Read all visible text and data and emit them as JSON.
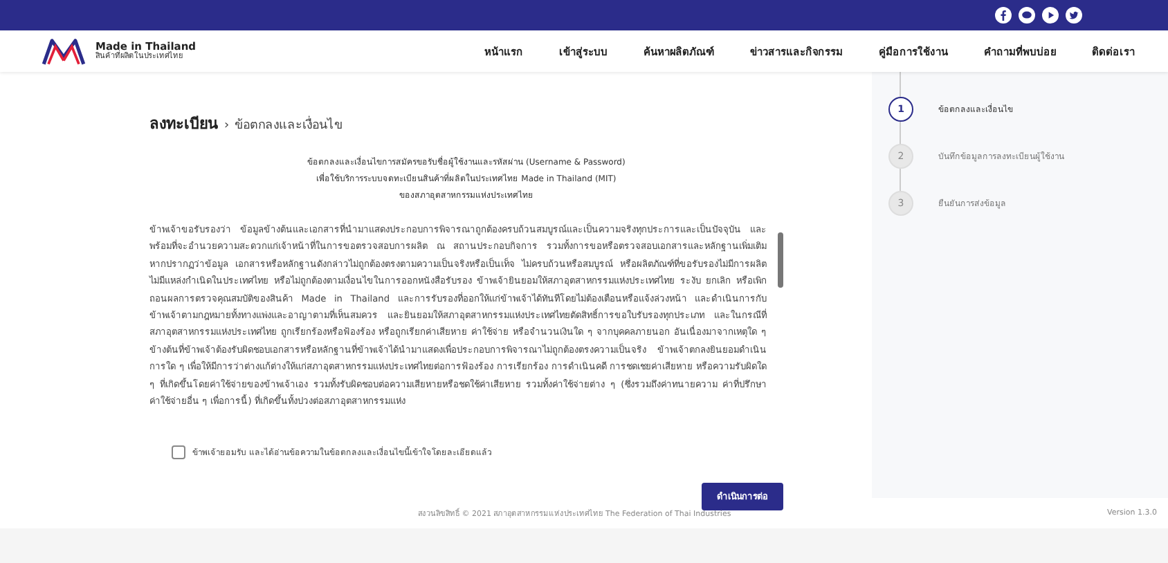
{
  "social_links": [
    {
      "kind": "facebook"
    },
    {
      "kind": "line"
    },
    {
      "kind": "youtube"
    },
    {
      "kind": "twitter"
    }
  ],
  "logo": {
    "title": "Made in Thailand",
    "subtitle": "สินค้าที่ผลิตในประเทศไทย"
  },
  "nav": [
    "หน้าแรก",
    "เข้าสู่ระบบ",
    "ค้นหาผลิตภัณฑ์",
    "ข่าวสารและกิจกรรม",
    "คู่มือการใช้งาน",
    "คำถามที่พบบ่อย",
    "ติดต่อเรา"
  ],
  "breadcrumb": {
    "parent": "ลงทะเบียน",
    "separator": "›",
    "current": "ข้อตกลงและเงื่อนไข"
  },
  "terms_title": [
    "ข้อตกลงและเงื่อนไขการสมัครขอรับชื่อผู้ใช้งานและรหัสผ่าน (Username & Password)",
    "เพื่อใช้บริการระบบจดทะเบียนสินค้าที่ผลิตในประเทศไทย Made in Thailand (MIT)",
    "ของสภาอุตสาหกรรมแห่งประเทศไทย"
  ],
  "terms_text": "ข้าพเจ้าขอรับรองว่า ข้อมูลข้างต้นและเอกสารที่นำมาแสดงประกอบการพิจารณาถูกต้องครบถ้วนสมบูรณ์และเป็นความจริงทุกประการและเป็นปัจจุบัน และพร้อมที่จะอำนวยความสะดวกแก่เจ้าหน้าที่ในการขอตรวจสอบการผลิต ณ สถานประกอบกิจการ รวมทั้งการขอหรือตรวจสอบเอกสารและหลักฐานเพิ่มเติม หากปรากฏว่าข้อมูล เอกสารหรือหลักฐานดังกล่าวไม่ถูกต้องตรงตามความเป็นจริงหรือเป็นเท็จ ไม่ครบถ้วนหรือสมบูรณ์ หรือผลิตภัณฑ์ที่ขอรับรองไม่มีการผลิต ไม่มีแหล่งกำเนิดในประเทศไทย หรือไม่ถูกต้องตามเงื่อนไขในการออกหนังสือรับรอง ข้าพเจ้ายินยอมให้สภาอุตสาหกรรมแห่งประเทศไทย ระงับ ยกเลิก หรือเพิกถอนผลการตรวจคุณสมบัติของสินค้า Made in Thailand และการรับรองที่ออกให้แก่ข้าพเจ้าได้ทันทีโดยไม่ต้องเตือนหรือแจ้งล่วงหน้า และดำเนินการกับข้าพเจ้าตามกฎหมายทั้งทางแพ่งและอาญาตามที่เห็นสมควร และยินยอมให้สภาอุตสาหกรรมแห่งประเทศไทยตัดสิทธิ์การขอใบรับรองทุกประเภท และในกรณีที่ สภาอุตสาหกรรมแห่งประเทศไทย ถูกเรียกร้องหรือฟ้องร้อง หรือถูกเรียกค่าเสียหาย ค่าใช้จ่าย หรือจำนวนเงินใด ๆ จากบุคคลภายนอก อันเนื่องมาจากเหตุใด ๆ ข้างต้นที่ข้าพเจ้าต้องรับผิดชอบเอกสารหรือหลักฐานที่ข้าพเจ้าได้นำมาแสดงเพื่อประกอบการพิจารณาไม่ถูกต้องตรงความเป็นจริง ข้าพเจ้าตกลงยินยอมดำเนินการใด ๆ เพื่อให้มีการว่าต่างแก้ต่างให้แก่สภาอุตสาหกรรมแห่งประเทศไทยต่อการฟ้องร้อง การเรียกร้อง การดำเนินคดี การชดเชยค่าเสียหาย หรือความรับผิดใด ๆ ที่เกิดขึ้นโดยค่าใช้จ่ายของข้าพเจ้าเอง รวมทั้งรับผิดชอบต่อความเสียหายหรือชดใช้ค่าเสียหาย รวมทั้งค่าใช้จ่ายต่าง ๆ (ซึ่งรวมถึงค่าทนายความ ค่าที่ปรึกษา ค่าใช้จ่ายอื่น ๆ เพื่อการนี้) ที่เกิดขึ้นทั้งปวงต่อสภาอุตสาหกรรมแห่ง",
  "accept": {
    "label": "ข้าพเจ้ายอมรับ และได้อ่านข้อความในข้อตกลงและเงื่อนไขนี้เข้าใจโดยละเอียดแล้ว",
    "checked": false
  },
  "continue_button": "ดำเนินการต่อ",
  "steps": [
    {
      "number": "1",
      "label": "ข้อตกลงและเงื่อนไข",
      "selected": true
    },
    {
      "number": "2",
      "label": "บันทึกข้อมูลการลงทะเบียนผู้ใช้งาน",
      "selected": false
    },
    {
      "number": "3",
      "label": "ยืนยันการส่งข้อมูล",
      "selected": false
    }
  ],
  "footer": {
    "copyright": "สงวนลิขสิทธิ์ © 2021 สภาอุตสาหกรรมแห่งประเทศไทย The Federation of Thai Industries",
    "version": "Version 1.3.0"
  }
}
